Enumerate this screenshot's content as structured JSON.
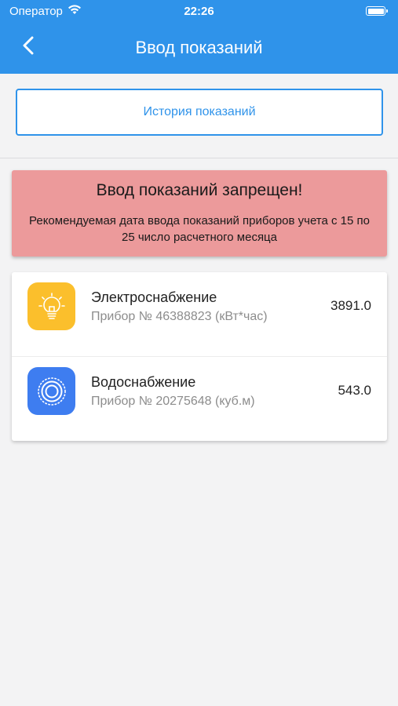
{
  "status_bar": {
    "carrier": "Оператор",
    "time": "22:26"
  },
  "nav": {
    "title": "Ввод показаний"
  },
  "history_button": {
    "label": "История показаний"
  },
  "warning": {
    "title": "Ввод показаний запрещен!",
    "text": "Рекомендуемая дата ввода показаний приборов учета с 15 по 25 число расчетного месяца"
  },
  "meters": [
    {
      "name": "Электроснабжение",
      "device": "Прибор № 46388823 (кВт*час)",
      "value": "3891.0",
      "icon": "lightbulb-icon",
      "color": "#fbbf2c"
    },
    {
      "name": "Водоснабжение",
      "device": "Прибор № 20275648 (куб.м)",
      "value": "543.0",
      "icon": "water-meter-icon",
      "color": "#3e7df0"
    }
  ],
  "colors": {
    "accent": "#2f93ea",
    "warning_bg": "#ec9a9b"
  }
}
